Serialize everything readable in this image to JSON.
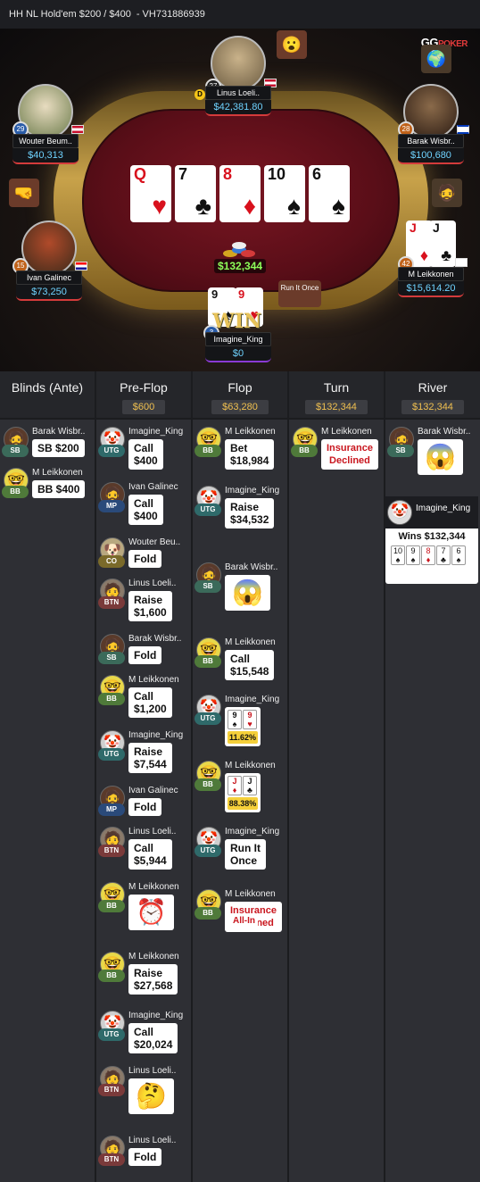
{
  "header": {
    "game": "HH NL Hold'em $200 / $400",
    "hand_id": "- VH731886939"
  },
  "logo": {
    "gg": "GG",
    "poker": "POKER"
  },
  "seats": {
    "top": {
      "name": "Linus Loeli..",
      "stack": "$42,381.80",
      "level": "27"
    },
    "left_top": {
      "name": "Wouter Beum..",
      "stack": "$40,313",
      "level": "29"
    },
    "right_top": {
      "name": "Barak Wisbr..",
      "stack": "$100,680",
      "level": "28"
    },
    "left_mid": {
      "name": "Ivan Galinec",
      "stack": "$73,250",
      "level": "15"
    },
    "right_mid": {
      "name": "M Leikkonen",
      "stack": "$15,614.20",
      "level": "42"
    },
    "hero": {
      "name": "Imagine_King",
      "stack": "$0",
      "level": "3"
    }
  },
  "dealer_label": "D",
  "board": [
    {
      "rank": "Q",
      "suit": "♥",
      "color": "red"
    },
    {
      "rank": "7",
      "suit": "♣",
      "color": "black"
    },
    {
      "rank": "8",
      "suit": "♦",
      "color": "red"
    },
    {
      "rank": "10",
      "suit": "♠",
      "color": "black"
    },
    {
      "rank": "6",
      "suit": "♠",
      "color": "black"
    }
  ],
  "pot": "$132,344",
  "run_it_once": "Run It Once",
  "hero_cards": [
    {
      "rank": "9",
      "suit": "♠"
    },
    {
      "rank": "9",
      "suit": "♥"
    }
  ],
  "right_mid_cards": [
    {
      "rank": "J",
      "suit": "♦"
    },
    {
      "rank": "J",
      "suit": "♣"
    }
  ],
  "win_text": "WIN",
  "columns": {
    "blinds": {
      "title": "Blinds (Ante)"
    },
    "preflop": {
      "title": "Pre-Flop",
      "pot": "$600"
    },
    "flop": {
      "title": "Flop",
      "pot": "$63,280"
    },
    "turn": {
      "title": "Turn",
      "pot": "$132,344"
    },
    "river": {
      "title": "River",
      "pot": "$132,344"
    }
  },
  "blinds_actions": [
    {
      "name": "Barak Wisbr..",
      "pos": "SB",
      "action": "SB $200"
    },
    {
      "name": "M Leikkonen",
      "pos": "BB",
      "action": "BB $400"
    }
  ],
  "preflop_actions": [
    {
      "name": "Imagine_King",
      "pos": "UTG",
      "action": "Call",
      "amount": "$400"
    },
    {
      "name": "Ivan Galinec",
      "pos": "MP",
      "action": "Call",
      "amount": "$400"
    },
    {
      "name": "Wouter Beu..",
      "pos": "CO",
      "action": "Fold"
    },
    {
      "name": "Linus Loeli..",
      "pos": "BTN",
      "action": "Raise",
      "amount": "$1,600"
    },
    {
      "name": "Barak Wisbr..",
      "pos": "SB",
      "action": "Fold"
    },
    {
      "name": "M Leikkonen",
      "pos": "BB",
      "action": "Call",
      "amount": "$1,200"
    },
    {
      "name": "Imagine_King",
      "pos": "UTG",
      "action": "Raise",
      "amount": "$7,544"
    },
    {
      "name": "Ivan Galinec",
      "pos": "MP",
      "action": "Fold"
    },
    {
      "name": "Linus Loeli..",
      "pos": "BTN",
      "action": "Call",
      "amount": "$5,944"
    },
    {
      "name": "M Leikkonen",
      "pos": "BB",
      "emoji": "⏰"
    },
    {
      "name": "M Leikkonen",
      "pos": "BB",
      "action": "Raise",
      "amount": "$27,568"
    },
    {
      "name": "Imagine_King",
      "pos": "UTG",
      "action": "Call",
      "amount": "$20,024"
    },
    {
      "name": "Linus Loeli..",
      "pos": "BTN",
      "emoji": "🤔"
    },
    {
      "name": "Linus Loeli..",
      "pos": "BTN",
      "action": "Fold"
    }
  ],
  "flop_actions": [
    {
      "name": "M Leikkonen",
      "pos": "BB",
      "action": "Bet",
      "amount": "$18,984"
    },
    {
      "name": "Imagine_King",
      "pos": "UTG",
      "action": "Raise",
      "amount": "$34,532"
    },
    {
      "name": "Barak Wisbr..",
      "pos": "SB",
      "emoji": "😱"
    },
    {
      "name": "M Leikkonen",
      "pos": "BB",
      "action": "Call",
      "amount": "$15,548"
    },
    {
      "name": "Imagine_King",
      "pos": "UTG",
      "equity": "11.62%"
    },
    {
      "name": "M Leikkonen",
      "pos": "BB",
      "equity": "88.38%"
    },
    {
      "name": "Imagine_King",
      "pos": "UTG",
      "action": "Run It",
      "amount": "Once"
    },
    {
      "name": "M Leikkonen",
      "pos": "BB",
      "action": "Insurance",
      "amount": "Declined"
    }
  ],
  "allin_label": "All-In",
  "turn_actions": [
    {
      "name": "M Leikkonen",
      "pos": "BB",
      "action": "Insurance",
      "amount": "Declined"
    }
  ],
  "river_actions": [
    {
      "name": "Barak Wisbr..",
      "pos": "SB",
      "emoji": "😱"
    }
  ],
  "winner": {
    "name": "Imagine_King",
    "text": "Wins $132,344"
  },
  "winner_cards": [
    {
      "rank": "10",
      "suit": "♠",
      "color": "black"
    },
    {
      "rank": "9",
      "suit": "♠",
      "color": "black"
    },
    {
      "rank": "8",
      "suit": "♦",
      "color": "red"
    },
    {
      "rank": "7",
      "suit": "♣",
      "color": "black"
    },
    {
      "rank": "6",
      "suit": "♠",
      "color": "black"
    }
  ],
  "colors": {
    "stack_blue": "#6fd3ff",
    "pot_green": "#8dff5a",
    "pot_gold": "#f0c050",
    "insurance_red": "#c9161e"
  }
}
